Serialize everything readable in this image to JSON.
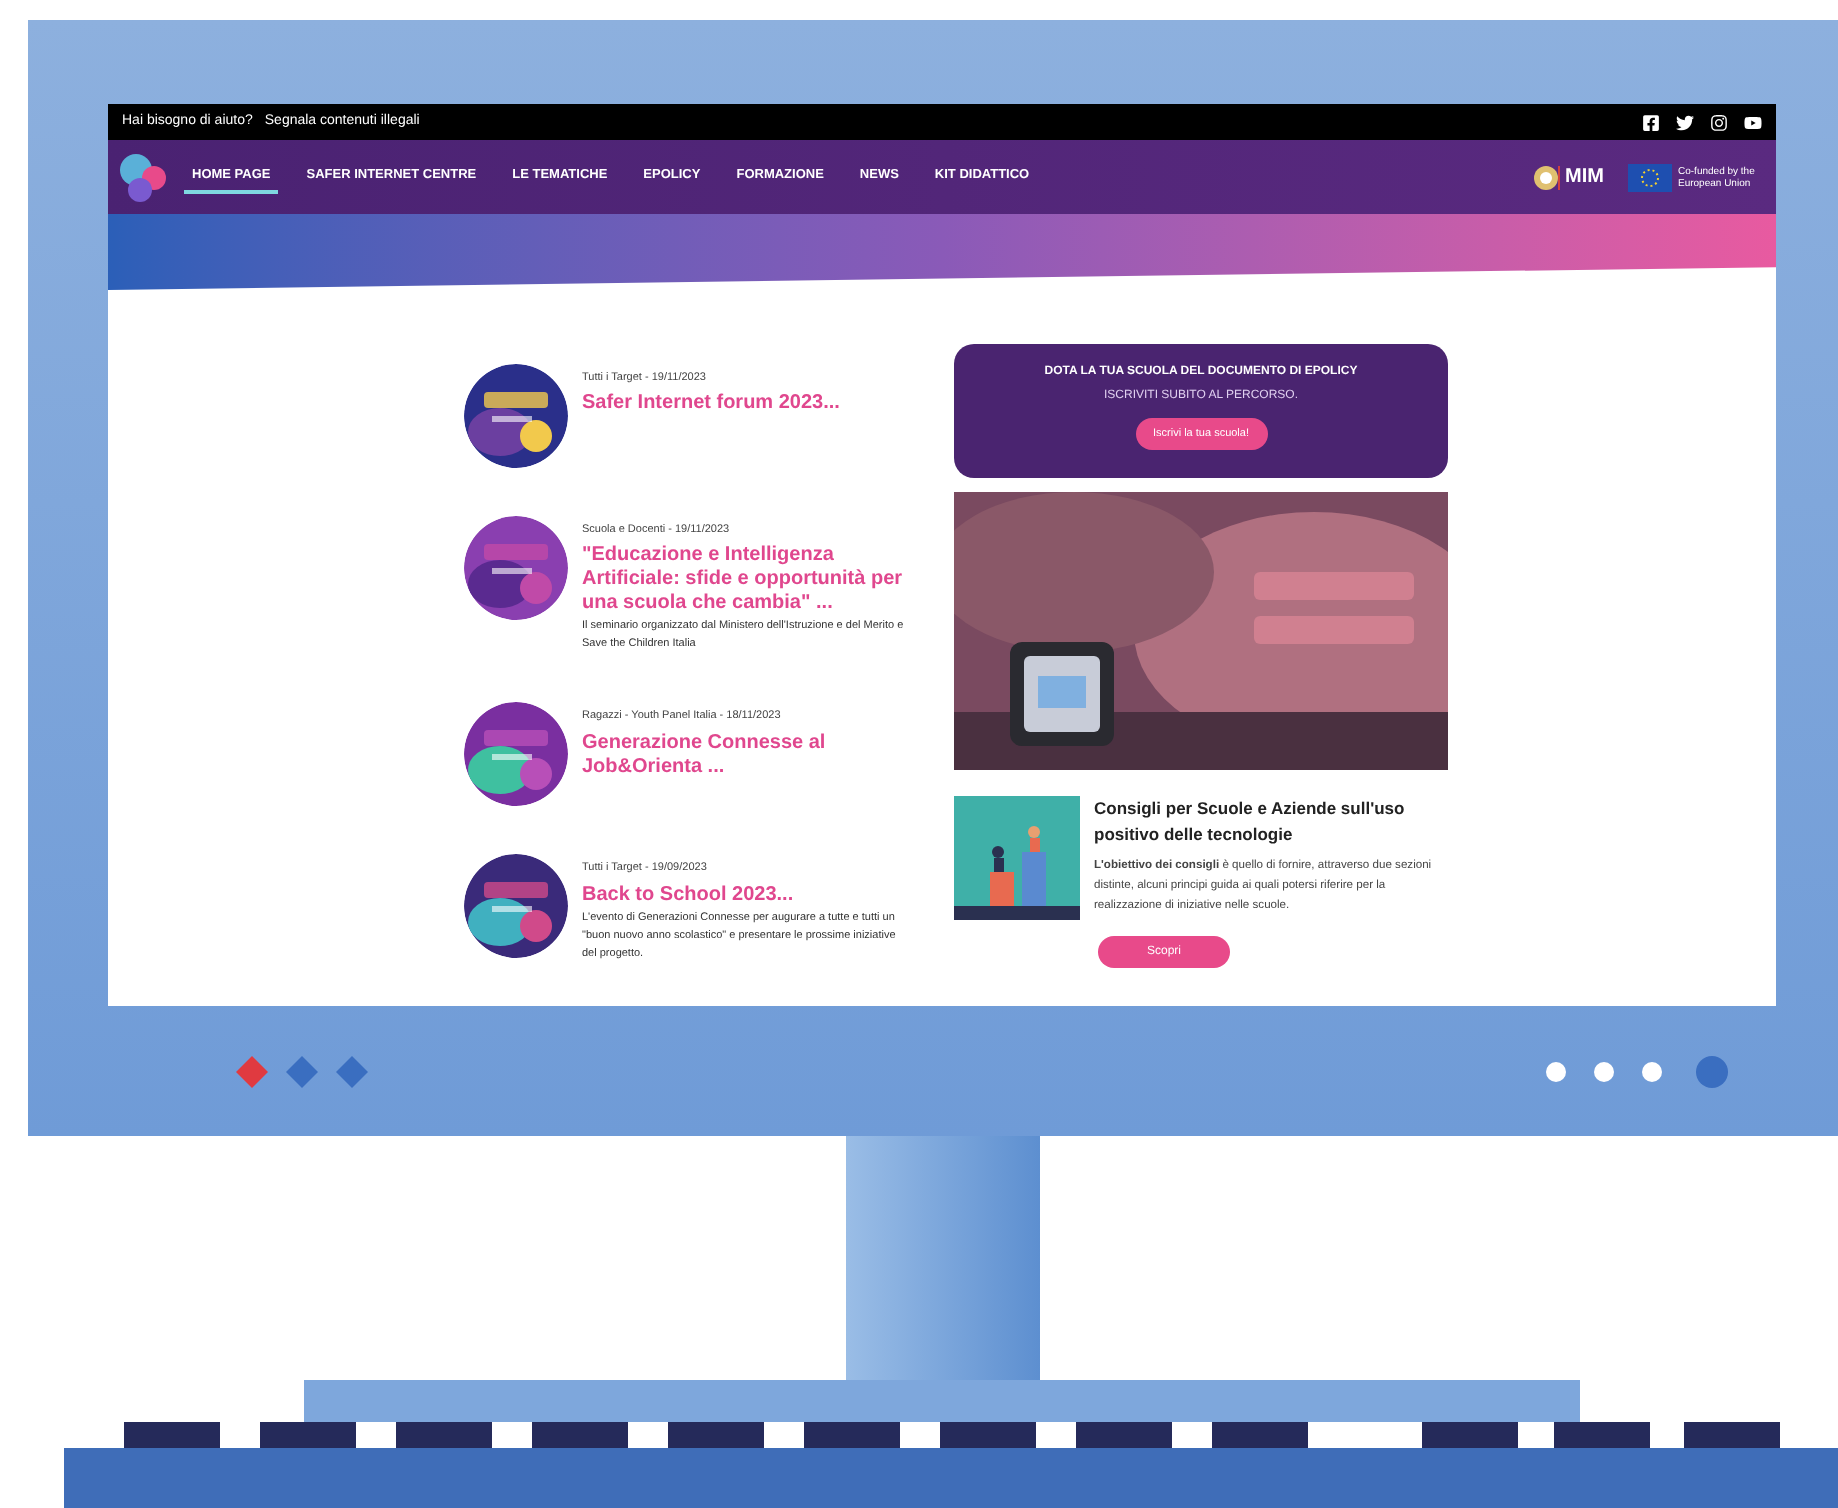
{
  "top_bar": {
    "links": [
      "Hai bisogno di aiuto?",
      "Segnala contenuti illegali"
    ]
  },
  "nav": {
    "items": [
      {
        "label": "HOME PAGE",
        "selected": true
      },
      {
        "label": "SAFER INTERNET CENTRE",
        "selected": false
      },
      {
        "label": "LE TEMATICHE",
        "selected": false
      },
      {
        "label": "EPOLICY",
        "selected": false
      },
      {
        "label": "FORMAZIONE",
        "selected": false
      },
      {
        "label": "NEWS",
        "selected": false
      },
      {
        "label": "KIT DIDATTICO",
        "selected": false
      }
    ],
    "partners": [
      {
        "kind": "mim",
        "text": "MIM"
      },
      {
        "kind": "eu",
        "text": "Co-funded by the European Union"
      }
    ]
  },
  "news": [
    {
      "meta": "Tutti i Target - 19/11/2023",
      "title": "Safer Internet forum 2023..."
    },
    {
      "meta": "Scuola e Docenti - 19/11/2023",
      "title": "\"Educazione e Intelligenza Artificiale: sfide e opportunità per una scuola che cambia\" ...",
      "text": "Il seminario organizzato dal Ministero dell'Istruzione e del Merito e Save the Children Italia"
    },
    {
      "meta": "Ragazzi - Youth Panel Italia - 18/11/2023",
      "title": "Generazione Connesse al Job&Orienta ..."
    },
    {
      "meta": "Tutti i Target - 19/09/2023",
      "title": "Back to School 2023...",
      "text": "L'evento di Generazioni Connesse per augurare a tutte e tutti un \"buon nuovo anno scolastico\" e presentare le prossime iniziative del progetto."
    }
  ],
  "promo": {
    "title": "DOTA LA TUA SCUOLA DEL DOCUMENTO DI EPOLICY",
    "subtitle": "ISCRIVITI SUBITO AL PERCORSO.",
    "button": "Iscrivi la tua scuola!"
  },
  "article": {
    "title": "Consigli per Scuole e Aziende sull'uso positivo delle tecnologie",
    "text": "**L'obiettivo dei consigli** è quello di fornire, attraverso due sezioni distinte, alcuni principi guida ai quali potersi riferire per la realizzazione di iniziative nelle scuole.",
    "button": "Scopri"
  }
}
